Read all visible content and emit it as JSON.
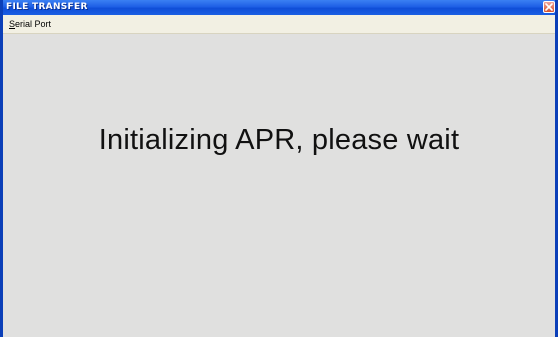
{
  "window": {
    "title": "FILE TRANSFER"
  },
  "menubar": {
    "items": [
      {
        "mnemonic": "S",
        "rest": "erial Port"
      }
    ]
  },
  "main": {
    "status_message": "Initializing APR, please wait"
  },
  "colors": {
    "titlebar": "#1f58d6",
    "menubar": "#f2f0e3",
    "client_background": "#e0e0df",
    "close_button": "#d6542e"
  },
  "icons": {
    "close": "close-icon"
  }
}
